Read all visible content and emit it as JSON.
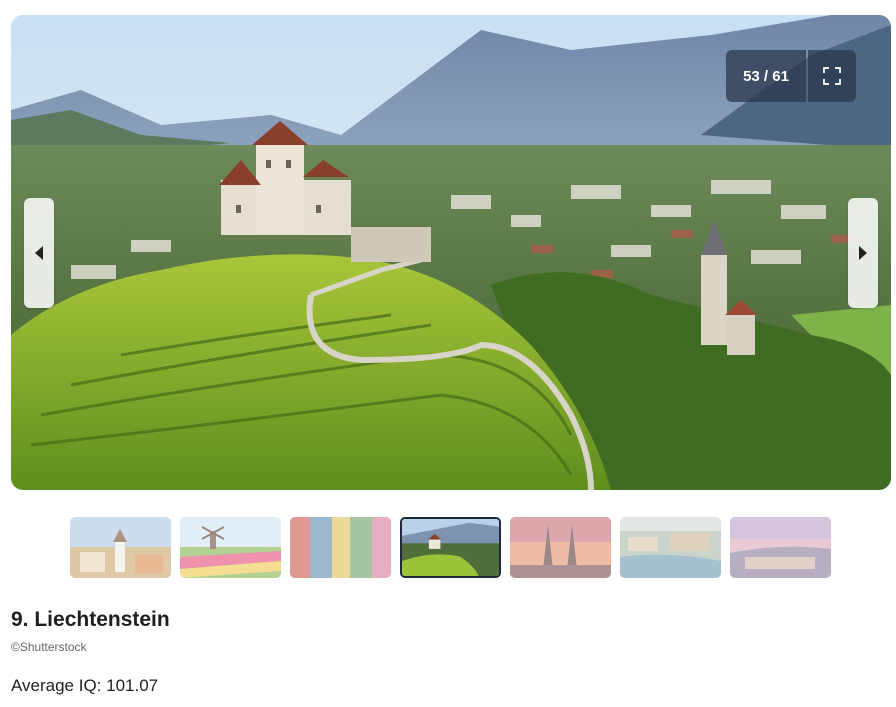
{
  "gallery": {
    "counter": "53 / 61",
    "fullscreen_icon": "fullscreen-icon",
    "prev_icon": "chevron-left-icon",
    "next_icon": "chevron-right-icon",
    "thumbnails": [
      {
        "subject": "town with church",
        "active": false
      },
      {
        "subject": "windmills and tulip fields",
        "active": false
      },
      {
        "subject": "colorful building facades",
        "active": false
      },
      {
        "subject": "castle on hill",
        "active": true
      },
      {
        "subject": "cathedral spires at sunset",
        "active": false
      },
      {
        "subject": "coastal city aerial",
        "active": false
      },
      {
        "subject": "city at dusk",
        "active": false
      }
    ]
  },
  "article": {
    "title": "9. Liechtenstein",
    "credit": "©Shutterstock",
    "stat": "Average IQ: 101.07"
  }
}
